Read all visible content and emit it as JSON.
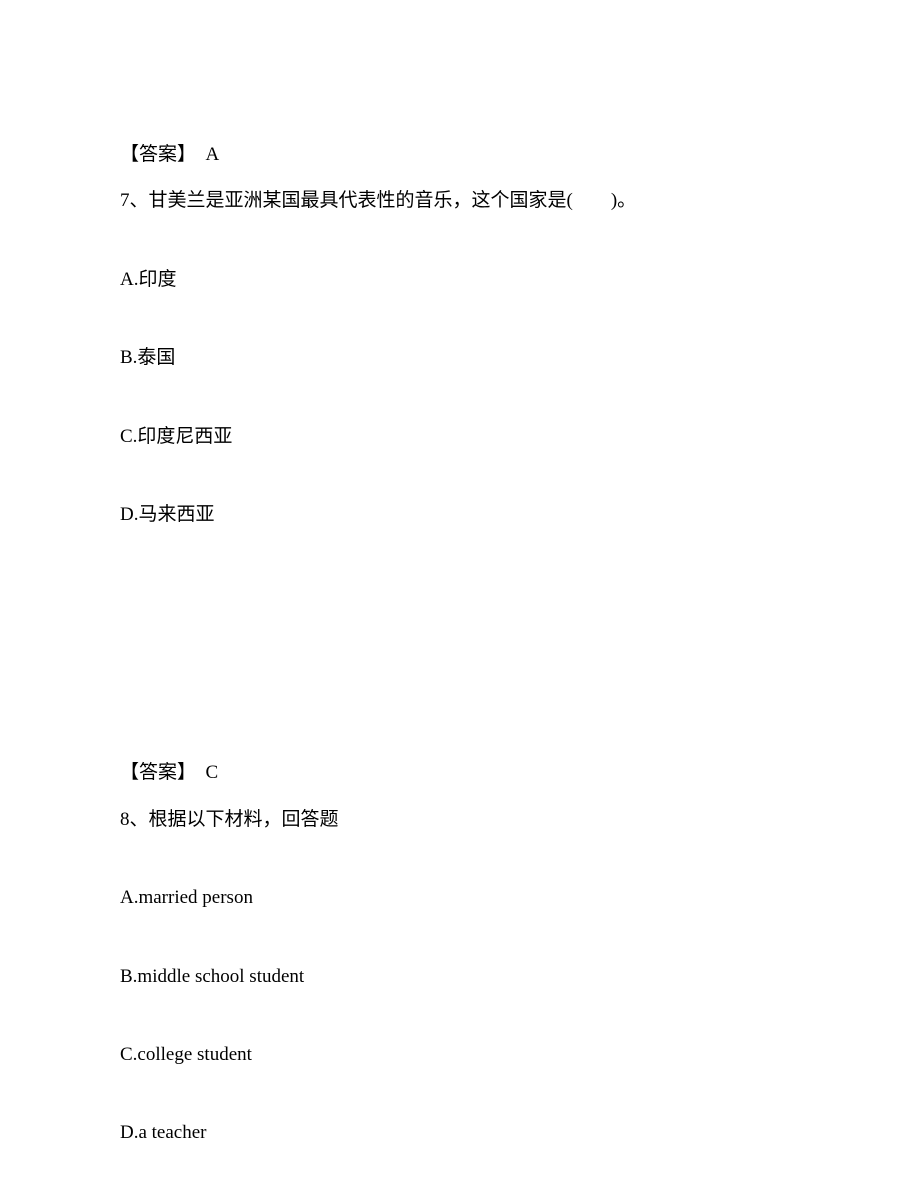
{
  "answer6": {
    "label": "【答案】",
    "value": "A"
  },
  "question7": {
    "number": "7、",
    "text": "甘美兰是亚洲某国最具代表性的音乐，这个国家是(　　)。",
    "options": {
      "a": "A.印度",
      "b": "B.泰国",
      "c": "C.印度尼西亚",
      "d": "D.马来西亚"
    }
  },
  "answer7": {
    "label": "【答案】",
    "value": "C"
  },
  "question8": {
    "number": "8、",
    "text": "根据以下材料，回答题",
    "options": {
      "a": "A.married person",
      "b": "B.middle school student",
      "c": "C.college student",
      "d": "D.a teacher"
    }
  }
}
